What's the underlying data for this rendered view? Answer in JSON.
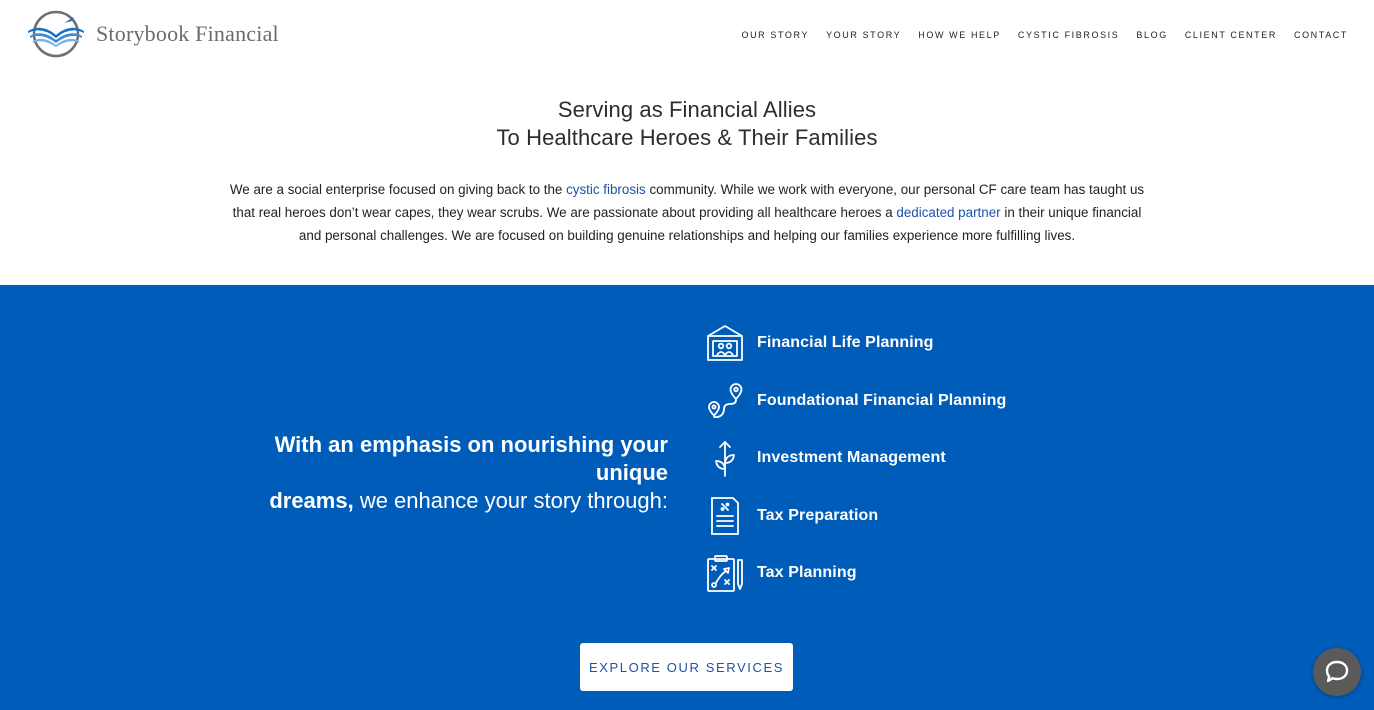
{
  "brand": {
    "name": "Storybook Financial",
    "accent": "#005cb9",
    "link_color": "#1d53a8"
  },
  "nav": [
    {
      "label": "OUR STORY"
    },
    {
      "label": "YOUR STORY"
    },
    {
      "label": "HOW WE HELP"
    },
    {
      "label": "CYSTIC FIBROSIS"
    },
    {
      "label": "BLOG"
    },
    {
      "label": "CLIENT CENTER"
    },
    {
      "label": "CONTACT"
    }
  ],
  "intro": {
    "title_line1": "Serving as Financial Allies",
    "title_line2": "To Healthcare Heroes & Their Families",
    "p_part1": "We are a social enterprise focused on giving back to the ",
    "link1": "cystic fibrosis",
    "p_part2": " community. While we work with everyone, our personal CF care team has taught us that real heroes don’t wear capes, they wear scrubs. We are passionate about providing all healthcare heroes a ",
    "link2": "dedicated partner",
    "p_part3": " in their unique financial and personal challenges. We are focused on building genuine relationships and helping our families experience more fulfilling lives."
  },
  "band": {
    "tagline_bold1": "With an emphasis on nourishing your unique",
    "tagline_bold2": "dreams,",
    "tagline_rest": " we enhance your story through:",
    "services": [
      {
        "label": "Financial Life Planning",
        "icon": "family-portrait-icon"
      },
      {
        "label": "Foundational Financial Planning",
        "icon": "route-map-pin-icon"
      },
      {
        "label": "Investment Management",
        "icon": "growth-plant-icon"
      },
      {
        "label": "Tax Preparation",
        "icon": "tax-document-icon"
      },
      {
        "label": "Tax Planning",
        "icon": "strategy-clipboard-icon"
      }
    ],
    "cta_label": "EXPLORE OUR SERVICES"
  },
  "chat": {
    "icon": "chat-bubble-icon"
  }
}
